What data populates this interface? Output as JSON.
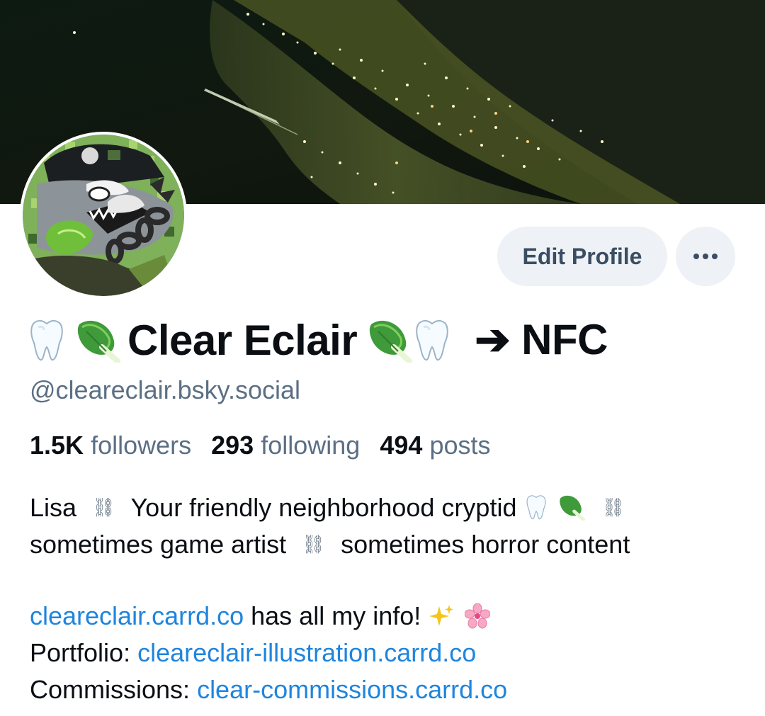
{
  "profile": {
    "display_name": "Clear Eclair",
    "redirect_label": "➔ NFC",
    "handle": "@cleareclair.bsky.social",
    "name_icons": [
      "tooth-icon",
      "bok-choy-icon"
    ]
  },
  "actions": {
    "edit_label": "Edit Profile",
    "more_label": "•••"
  },
  "stats": {
    "followers_count": "1.5K",
    "followers_label": "followers",
    "following_count": "293",
    "following_label": "following",
    "posts_count": "494",
    "posts_label": "posts"
  },
  "bio": {
    "line1_a": "Lisa",
    "line1_b": "Your friendly neighborhood cryptid",
    "line2_a": "sometimes game artist",
    "line2_b": "sometimes horror content",
    "separator": "⛓",
    "link1": "cleareclair.carrd.co",
    "link1_suffix": "has all my info!",
    "portfolio_label": "Portfolio:",
    "portfolio_link": "cleareclair-illustration.carrd.co",
    "commissions_label": "Commissions:",
    "commissions_link": "clear-commissions.carrd.co"
  },
  "colors": {
    "link": "#1f85dd",
    "muted": "#5b6f84",
    "button_bg": "#eef2f6",
    "button_text": "#3a4d63"
  }
}
